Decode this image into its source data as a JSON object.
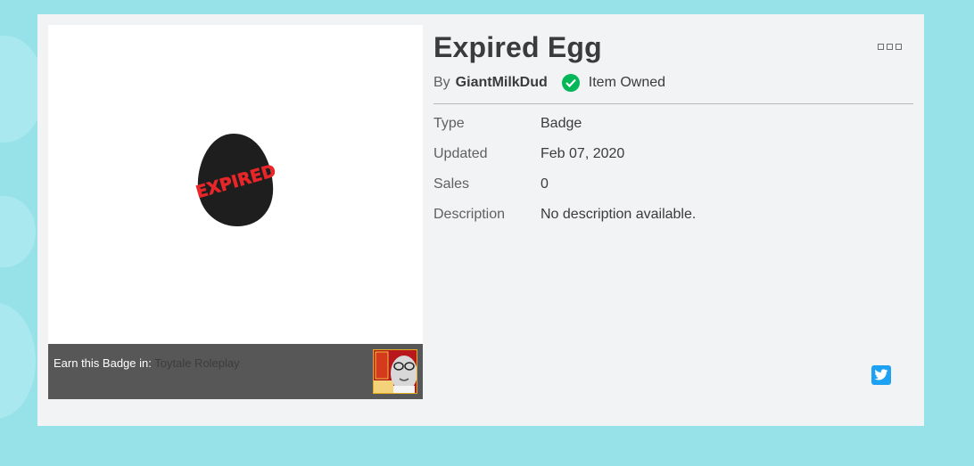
{
  "item": {
    "title": "Expired Egg",
    "by_label": "By",
    "creator": "GiantMilkDud",
    "owned_label": "Item Owned"
  },
  "details": [
    {
      "label": "Type",
      "value": "Badge"
    },
    {
      "label": "Updated",
      "value": "Feb 07, 2020"
    },
    {
      "label": "Sales",
      "value": "0"
    },
    {
      "label": "Description",
      "value": "No description available."
    }
  ],
  "thumbnail": {
    "egg_text": "EXPIRED"
  },
  "earn": {
    "prefix": "Earn this Badge in:",
    "game_name": "Toytale Roleplay"
  },
  "icons": {
    "more": "more-options-icon",
    "owned": "checkmark-icon",
    "share": "twitter-icon"
  },
  "colors": {
    "background": "#97e1e8",
    "card": "#f1f3f5",
    "owned_green": "#02b757",
    "twitter": "#1da1f2",
    "earn_bar": "#575757"
  }
}
